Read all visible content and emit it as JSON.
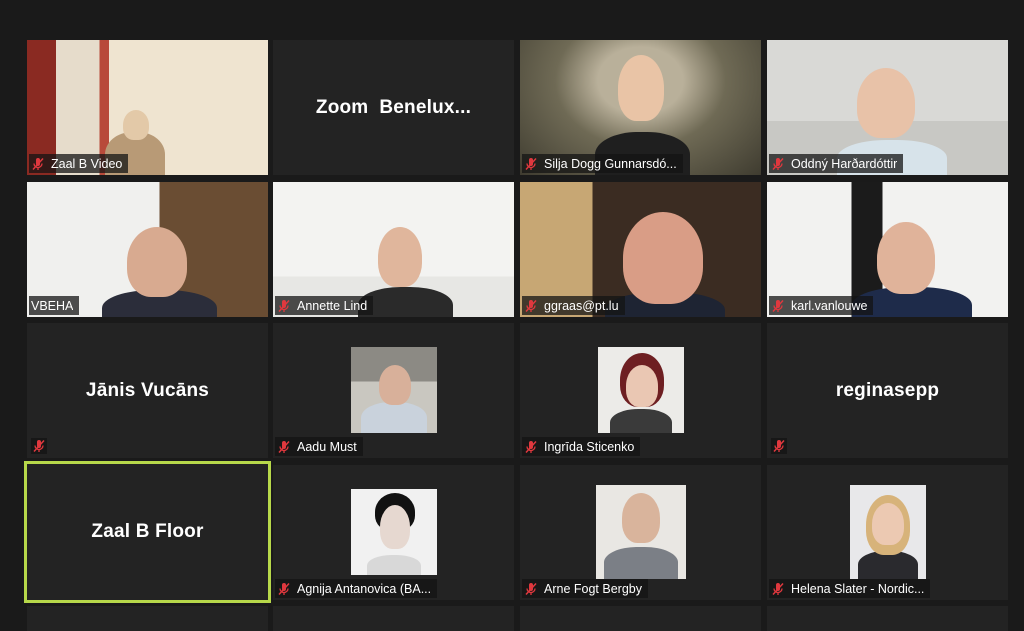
{
  "app": {
    "title": "Zoom gallery view"
  },
  "colors": {
    "speaking_border": "#b7d84a",
    "mute_icon": "#e0383e",
    "tile_bg": "#232323"
  },
  "participants": [
    {
      "name": "Zaal B Video",
      "muted": true
    },
    {
      "name": "Zoom  Benelux..."
    },
    {
      "name": "Silja Dogg Gunnarsdó...",
      "muted": true
    },
    {
      "name": "Oddný Harðardóttir",
      "muted": true
    },
    {
      "name": "VBEHA",
      "muted": false
    },
    {
      "name": "Annette Lind",
      "muted": true
    },
    {
      "name": "ggraas@pt.lu",
      "muted": true
    },
    {
      "name": "karl.vanlouwe",
      "muted": true
    },
    {
      "name": "Jānis Vucāns",
      "muted": true
    },
    {
      "name": "Aadu Must",
      "muted": true
    },
    {
      "name": "Ingrīda Sticenko",
      "muted": true
    },
    {
      "name": "reginasepp",
      "muted": true
    },
    {
      "name": "Zaal B Floor",
      "active_speaker": true
    },
    {
      "name": "Agnija Antanovica (BA...",
      "muted": true
    },
    {
      "name": "Arne Fogt Bergby",
      "muted": true
    },
    {
      "name": "Helena Slater - Nordic...",
      "muted": true
    }
  ]
}
